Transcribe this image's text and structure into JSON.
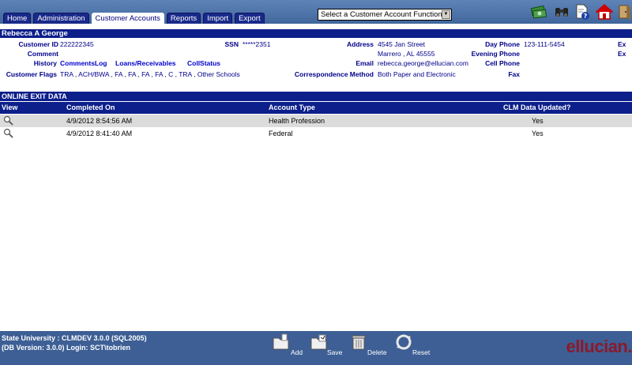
{
  "tabs": [
    {
      "label": "Home"
    },
    {
      "label": "Administration"
    },
    {
      "label": "Customer Accounts"
    },
    {
      "label": "Reports"
    },
    {
      "label": "Import"
    },
    {
      "label": "Export"
    }
  ],
  "function_select": {
    "value": "Select a Customer Account Function"
  },
  "toolbar_icons": [
    "money-icon",
    "binoculars-icon",
    "help-document-icon",
    "home-icon",
    "logout-icon"
  ],
  "customer": {
    "name": "Rebecca A George",
    "customer_id_label": "Customer ID",
    "customer_id": "222222345",
    "ssn_label": "SSN",
    "ssn": "*****2351",
    "address_label": "Address",
    "address_line1": "4545 Jan Street",
    "address_line2": "Marrero , AL 45555",
    "day_phone_label": "Day Phone",
    "day_phone": "123-111-5454",
    "evening_phone_label": "Evening Phone",
    "cell_phone_label": "Cell Phone",
    "fax_label": "Fax",
    "comment_label": "Comment",
    "email_label": "Email",
    "email": "rebecca.george@ellucian.com",
    "correspondence_label": "Correspondence Method",
    "correspondence": "Both Paper and Electronic",
    "history_label": "History",
    "history_links": [
      "CommentsLog",
      "Loans/Receivables",
      "CollStatus"
    ],
    "flags_label": "Customer Flags",
    "flags_value": "TRA , ACH/BWA , FA , FA , FA , FA , C , TRA , Other Schools",
    "ex1": "Ex",
    "ex2": "Ex"
  },
  "exit_data": {
    "title": "ONLINE EXIT DATA",
    "columns": [
      "View",
      "Completed On",
      "Account Type",
      "CLM Data Updated?"
    ],
    "rows": [
      {
        "completed_on": "4/9/2012 8:54:56 AM",
        "account_type": "Health Profession",
        "clm_updated": "Yes"
      },
      {
        "completed_on": "4/9/2012 8:41:40 AM",
        "account_type": "Federal",
        "clm_updated": "Yes"
      }
    ]
  },
  "footer": {
    "line1": "State University : CLMDEV 3.0.0 (SQL2005)",
    "line2": "(DB Version: 3.0.0) Login: SCT\\tobrien",
    "buttons": [
      {
        "label": "Add"
      },
      {
        "label": "Save"
      },
      {
        "label": "Delete"
      },
      {
        "label": "Reset"
      }
    ],
    "logo": "ellucian."
  },
  "colors": {
    "navy": "#0c1f8b",
    "footer_blue": "#3d5f95",
    "logo_red": "#8b1a2b"
  }
}
